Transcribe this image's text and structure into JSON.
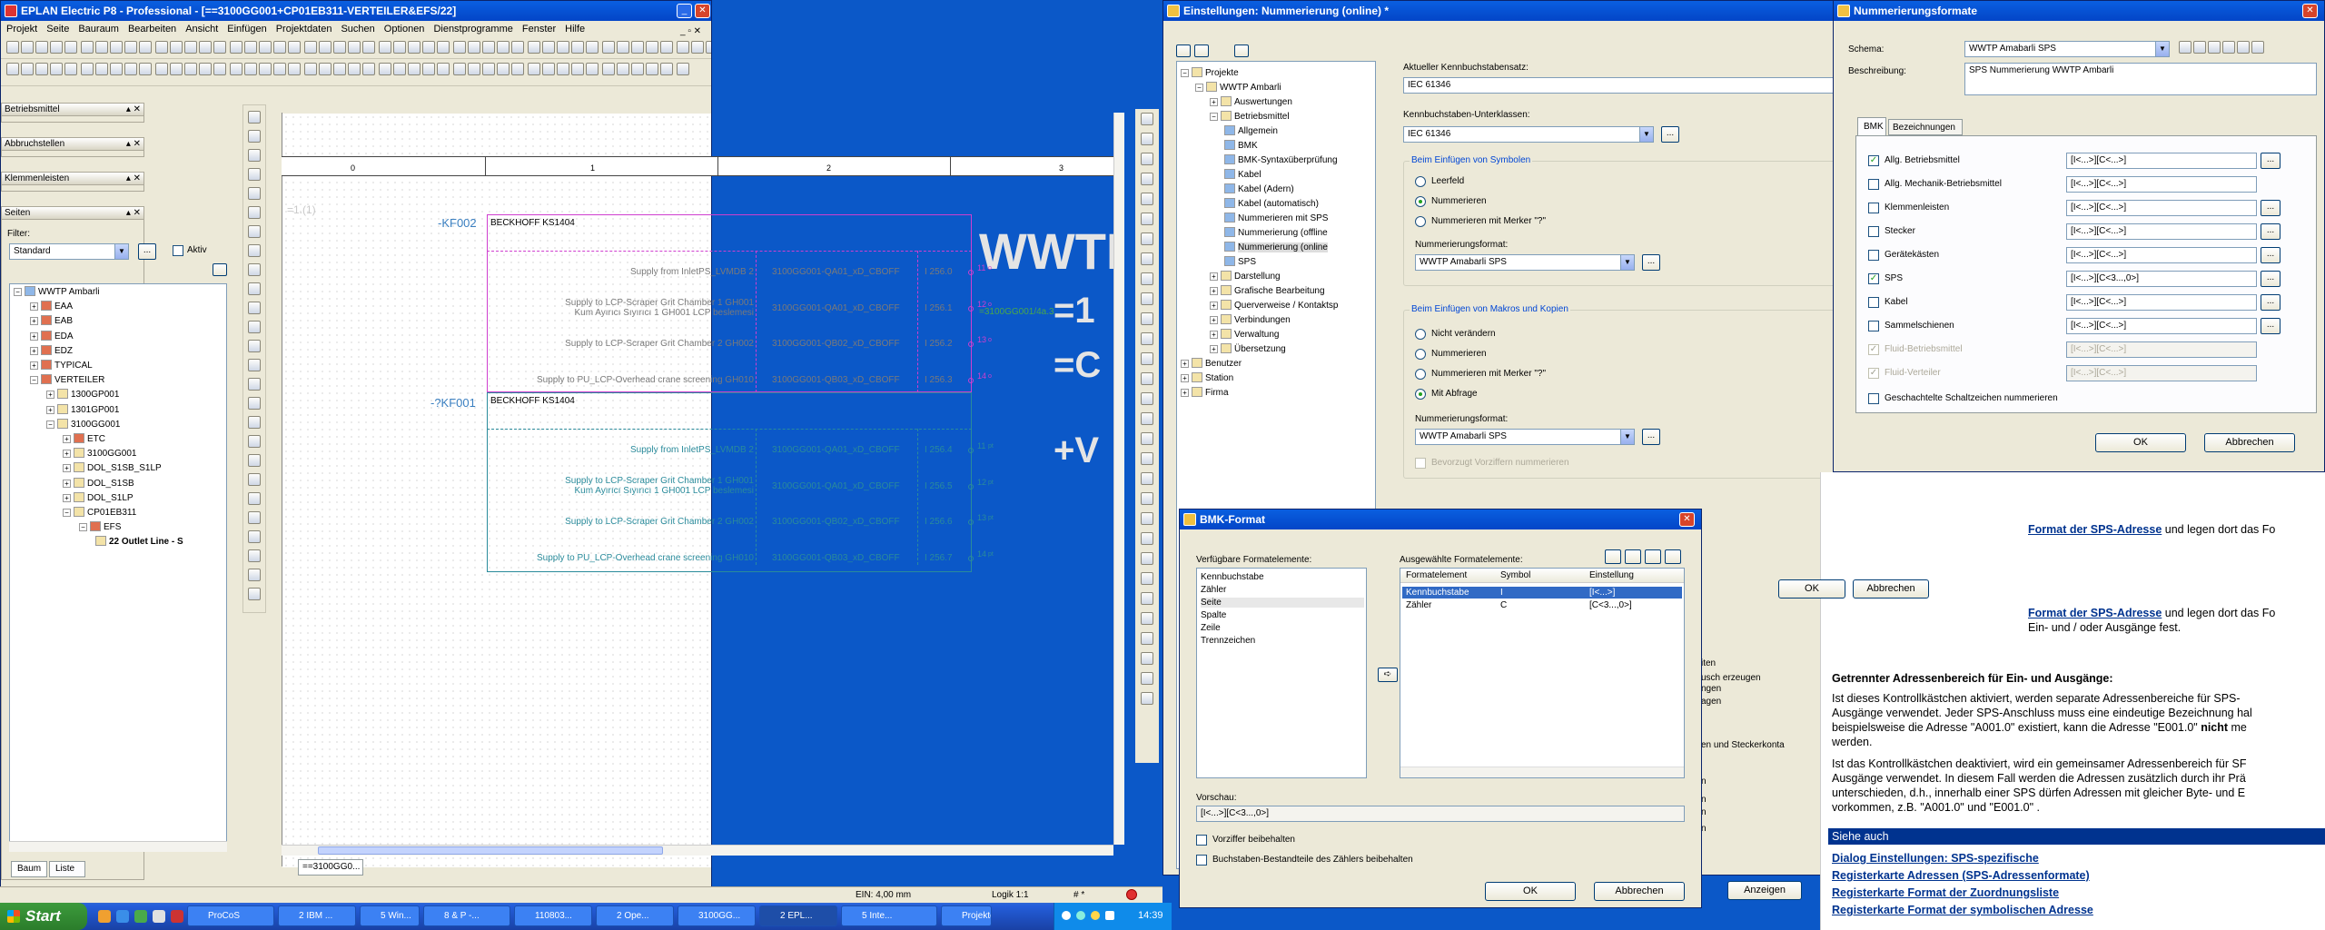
{
  "eplan": {
    "title": "EPLAN Electric P8 - Professional - [==3100GG001+CP01EB311-VERTEILER&EFS/22]",
    "menu": [
      "Projekt",
      "Seite",
      "Bauraum",
      "Bearbeiten",
      "Ansicht",
      "Einfügen",
      "Projektdaten",
      "Suchen",
      "Optionen",
      "Dienstprogramme",
      "Fenster",
      "Hilfe"
    ],
    "panels": {
      "betriebsmittel": "Betriebsmittel",
      "abbruchstellen": "Abbruchstellen",
      "klemmenleisten": "Klemmenleisten",
      "seiten": "Seiten"
    },
    "filter_label": "Filter:",
    "filter_value": "Standard",
    "aktiv": "Aktiv",
    "tree": [
      "WWTP Ambarli",
      "EAA",
      "EAB",
      "EDA",
      "EDZ",
      "TYPICAL",
      "VERTEILER",
      "1300GP001",
      "1301GP001",
      "3100GG001",
      "ETC",
      "3100GG001",
      "DOL_S1SB_S1LP",
      "DOL_S1SB",
      "DOL_S1LP",
      "CP01EB311",
      "EFS",
      "22 Outlet Line - S"
    ],
    "tabs": [
      "Baum",
      "Liste"
    ],
    "page_tab": "==3100GG0...",
    "ruler": [
      "0",
      "1",
      "2",
      "3"
    ],
    "status_ein": "EIN: 4,00 mm",
    "status_logik": "Logik 1:1",
    "status_hash": "# *",
    "wm": [
      "WWTF",
      "=1",
      "=C",
      "+V"
    ],
    "ghost": "=1.(1)",
    "block1": {
      "tag": "-KF002",
      "title": "BECKHOFF KS1404",
      "xref": "=3100GG001/4a.3"
    },
    "block2": {
      "tag": "-?KF001",
      "title": "BECKHOFF KS1404"
    },
    "rows1": [
      {
        "desc": "Supply from InletPS_LVMDB 2",
        "dev": "3100GG001-QA01_xD_CBOFF",
        "addr": "I 256.0",
        "pin": "11",
        "pt": "o"
      },
      {
        "desc": "Supply to LCP-Scraper Grit Chamber 1 GH001\nKum Ayırıcı Sıyırıcı 1 GH001 LCP beslemesi",
        "dev": "3100GG001-QA01_xD_CBOFF",
        "addr": "I 256.1",
        "pin": "12",
        "pt": "o"
      },
      {
        "desc": "Supply to LCP-Scraper Grit Chamber 2 GH002",
        "dev": "3100GG001-QB02_xD_CBOFF",
        "addr": "I 256.2",
        "pin": "13",
        "pt": "o"
      },
      {
        "desc": "Supply to PU_LCP-Overhead crane screening GH010",
        "dev": "3100GG001-QB03_xD_CBOFF",
        "addr": "I 256.3",
        "pin": "14",
        "pt": "o"
      }
    ],
    "rows2": [
      {
        "desc": "Supply from InletPS_LVMDB 2",
        "dev": "3100GG001-QA01_xD_CBOFF",
        "addr": "I 256.4",
        "pin": "11",
        "pt": "pt"
      },
      {
        "desc": "Supply to LCP-Scraper Grit Chamber 1 GH001\nKum Ayırıcı Sıyırıcı 1 GH001 LCP beslemesi",
        "dev": "3100GG001-QA01_xD_CBOFF",
        "addr": "I 256.5",
        "pin": "12",
        "pt": "pt"
      },
      {
        "desc": "Supply to LCP-Scraper Grit Chamber 2 GH002",
        "dev": "3100GG001-QB02_xD_CBOFF",
        "addr": "I 256.6",
        "pin": "13",
        "pt": "pt"
      },
      {
        "desc": "Supply to PU_LCP-Overhead crane screening GH010",
        "dev": "3100GG001-QB03_xD_CBOFF",
        "addr": "I 256.7",
        "pin": "14",
        "pt": "pt"
      }
    ]
  },
  "einst": {
    "title": "Einstellungen: Nummerierung (online) *",
    "tree": [
      "Projekte",
      "WWTP Ambarli",
      "Auswertungen",
      "Betriebsmittel",
      "Allgemein",
      "BMK",
      "BMK-Syntaxüberprüfung",
      "Kabel",
      "Kabel (Adern)",
      "Kabel (automatisch)",
      "Nummerieren mit SPS",
      "Nummerierung (offline",
      "Nummerierung (online",
      "SPS",
      "Darstellung",
      "Grafische Bearbeitung",
      "Querverweise / Kontaktsp",
      "Verbindungen",
      "Verwaltung",
      "Übersetzung",
      "Benutzer",
      "Station",
      "Firma"
    ],
    "kb_label": "Aktueller Kennbuchstabensatz:",
    "kb_value": "IEC 61346",
    "kbu_label": "Kennbuchstaben-Unterklassen:",
    "kbu_value": "IEC 61346",
    "sym_group": "Beim Einfügen von Symbolen",
    "sym_opts": [
      "Leerfeld",
      "Nummerieren",
      "Nummerieren mit Merker \"?\""
    ],
    "nf_label": "Nummerierungsformat:",
    "nf_value": "WWTP Amabarli SPS",
    "mak_group": "Beim Einfügen von Makros und Kopien",
    "mak_opts": [
      "Nicht verändern",
      "Nummerieren",
      "Nummerieren mit Merker \"?\"",
      "Mit Abfrage"
    ],
    "nf2_value": "WWTP Amabarli SPS",
    "bevorzugt": "Bevorzugt Vorziffern nummerieren",
    "ok": "OK",
    "abbrechen": "Abbrechen",
    "anzeigen": "Anzeigen",
    "partial": [
      "iten",
      "usch erzeugen",
      "ngen",
      "agen",
      "en und Steckerkonta",
      "n",
      "n",
      "n",
      "n"
    ]
  },
  "bmk": {
    "title": "BMK-Format",
    "avail_label": "Verfügbare Formatelemente:",
    "avail": [
      "Kennbuchstabe",
      "Zähler",
      "Seite",
      "Spalte",
      "Zeile",
      "Trennzeichen"
    ],
    "sel_label": "Ausgewählte Formatelemente:",
    "cols": [
      "Formatelement",
      "Symbol",
      "Einstellung"
    ],
    "rows": [
      {
        "e": "Kennbuchstabe",
        "s": "I",
        "v": "[I<...>]"
      },
      {
        "e": "Zähler",
        "s": "C",
        "v": "[C<3...,0>]"
      }
    ],
    "preview_label": "Vorschau:",
    "preview": "[I<...>][C<3...,0>]",
    "cb1": "Vorziffer beibehalten",
    "cb2": "Buchstaben-Bestandteile des Zählers beibehalten",
    "ok": "OK",
    "abbrechen": "Abbrechen"
  },
  "nf": {
    "title": "Nummerierungsformate",
    "schema_label": "Schema:",
    "schema": "WWTP Amabarli SPS",
    "beschr_label": "Beschreibung:",
    "beschr": "SPS Nummerierung WWTP Ambarli",
    "tabs": [
      "BMK",
      "Bezeichnungen"
    ],
    "rows": [
      {
        "l": "Allg. Betriebsmittel",
        "v": "[I<...>][C<...>]",
        "c": true,
        "b": true,
        "d": false
      },
      {
        "l": "Allg. Mechanik-Betriebsmittel",
        "v": "[I<...>][C<...>]",
        "c": false,
        "b": false,
        "d": false
      },
      {
        "l": "Klemmenleisten",
        "v": "[I<...>][C<...>]",
        "c": false,
        "b": true,
        "d": false
      },
      {
        "l": "Stecker",
        "v": "[I<...>][C<...>]",
        "c": false,
        "b": true,
        "d": false
      },
      {
        "l": "Gerätekästen",
        "v": "[I<...>][C<...>]",
        "c": false,
        "b": true,
        "d": false
      },
      {
        "l": "SPS",
        "v": "[I<...>][C<3...,0>]",
        "c": true,
        "b": true,
        "d": false
      },
      {
        "l": "Kabel",
        "v": "[I<...>][C<...>]",
        "c": false,
        "b": true,
        "d": false
      },
      {
        "l": "Sammelschienen",
        "v": "[I<...>][C<...>]",
        "c": false,
        "b": true,
        "d": false
      },
      {
        "l": "Fluid-Betriebsmittel",
        "v": "[I<...>][C<...>]",
        "c": true,
        "b": false,
        "d": true
      },
      {
        "l": "Fluid-Verteiler",
        "v": "[I<...>][C<...>]",
        "c": true,
        "b": false,
        "d": true
      }
    ],
    "nested": "Geschachtelte Schaltzeichen nummerieren",
    "ok": "OK",
    "abbrechen": "Abbrechen",
    "ok2": "OK",
    "abbrechen2": "Abbrechen"
  },
  "help": {
    "p1a": "Format der SPS-Adresse",
    "p1b": " und legen dort das Fo",
    "p2a": "Format der SPS-Adresse",
    "p2b": " und legen dort das Fo",
    "p2c": "Ein- und / oder Ausgänge fest.",
    "h": "Getrennter Adressenbereich für Ein- und Ausgänge:",
    "t1": "Ist dieses Kontrollkästchen aktiviert, werden separate Adressenbereiche für SPS-",
    "t2": "Ausgänge verwendet. Jeder SPS-Anschluss muss eine eindeutige Bezeichnung hal",
    "t3a": "beispielsweise die Adresse \"A001.0\" existiert, kann die Adresse \"E001.0\" ",
    "t3b": "nicht",
    "t3c": " me",
    "t4": "werden.",
    "t5": "Ist das Kontrollkästchen deaktiviert, wird ein gemeinsamer Adressenbereich für SF",
    "t6": "Ausgänge verwendet. In diesem Fall werden die Adressen zusätzlich durch ihr Prä",
    "t7": "unterschieden, d.h., innerhalb einer SPS dürfen Adressen mit gleicher Byte- und E",
    "t8": "vorkommen, z.B. \"A001.0\" und \"E001.0\" .",
    "see": "Siehe auch",
    "links": [
      "Dialog Einstellungen: SPS-spezifische",
      "Registerkarte Adressen (SPS-Adressenformate)",
      "Registerkarte Format der Zuordnungsliste",
      "Registerkarte Format der symbolischen Adresse"
    ]
  },
  "taskbar": {
    "start": "Start",
    "tasks": [
      "ProCoS",
      "2 IBM ...",
      "5 Win...",
      "8 & P -...",
      "110803...",
      "2 Ope...",
      "3100GG...",
      "2 EPL...",
      "5 Inte...",
      "Projekte"
    ],
    "time": "14:39"
  }
}
